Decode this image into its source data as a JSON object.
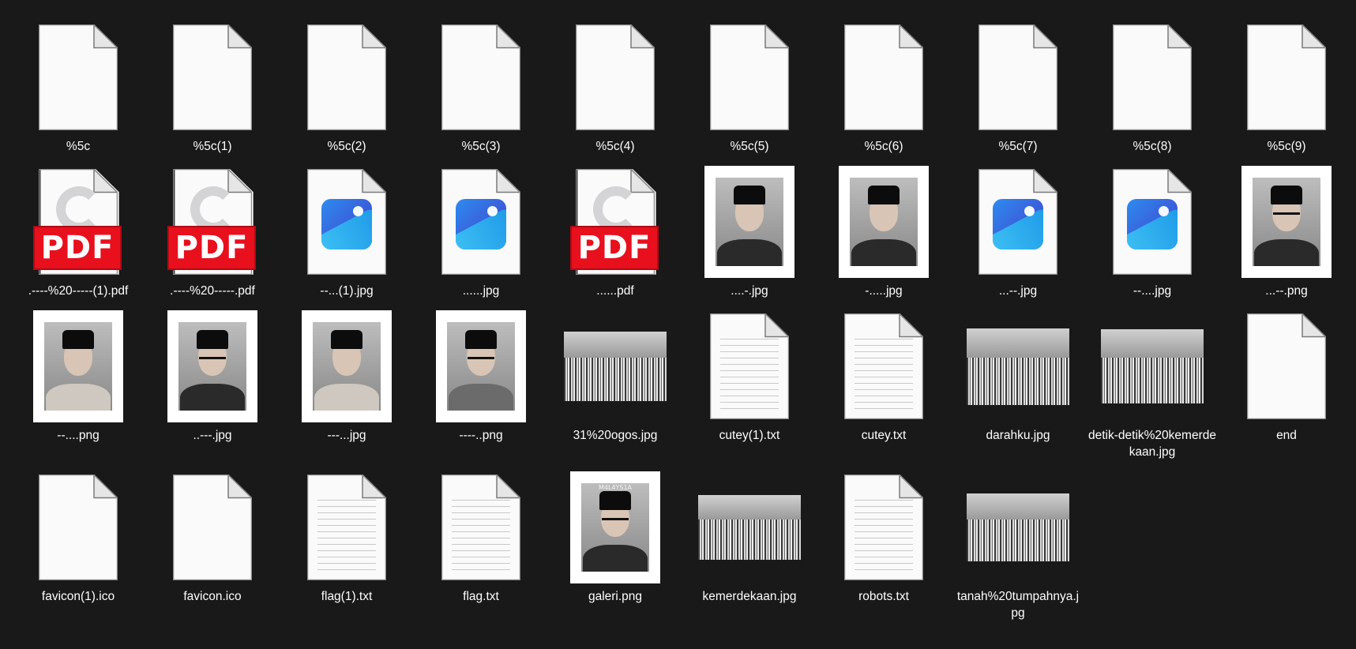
{
  "files": [
    {
      "name": "%5c",
      "kind": "blank"
    },
    {
      "name": "%5c(1)",
      "kind": "blank"
    },
    {
      "name": "%5c(2)",
      "kind": "blank"
    },
    {
      "name": "%5c(3)",
      "kind": "blank"
    },
    {
      "name": "%5c(4)",
      "kind": "blank"
    },
    {
      "name": "%5c(5)",
      "kind": "blank"
    },
    {
      "name": "%5c(6)",
      "kind": "blank"
    },
    {
      "name": "%5c(7)",
      "kind": "blank"
    },
    {
      "name": "%5c(8)",
      "kind": "blank"
    },
    {
      "name": "%5c(9)",
      "kind": "blank"
    },
    {
      "name": ".----%20-----(1).pdf",
      "kind": "pdf"
    },
    {
      "name": ".----%20-----.pdf",
      "kind": "pdf"
    },
    {
      "name": "--...(1).jpg",
      "kind": "image-icon"
    },
    {
      "name": "......jpg",
      "kind": "image-icon"
    },
    {
      "name": "......pdf",
      "kind": "pdf"
    },
    {
      "name": "....-.jpg",
      "kind": "portrait",
      "tone": "dark",
      "glasses": false
    },
    {
      "name": "-.....jpg",
      "kind": "portrait",
      "tone": "dark",
      "glasses": false
    },
    {
      "name": "...--.jpg",
      "kind": "image-icon"
    },
    {
      "name": "--....jpg",
      "kind": "image-icon"
    },
    {
      "name": "...--.png",
      "kind": "portrait",
      "tone": "dark",
      "glasses": true
    },
    {
      "name": "--....png",
      "kind": "portrait",
      "tone": "light",
      "glasses": false
    },
    {
      "name": "..---.jpg",
      "kind": "portrait",
      "tone": "dark",
      "glasses": true
    },
    {
      "name": "---...jpg",
      "kind": "portrait",
      "tone": "light",
      "glasses": false
    },
    {
      "name": "----..png",
      "kind": "portrait",
      "tone": "mid",
      "glasses": true
    },
    {
      "name": "31%20ogos.jpg",
      "kind": "photo",
      "w": 130,
      "h": 88
    },
    {
      "name": "cutey(1).txt",
      "kind": "text"
    },
    {
      "name": "cutey.txt",
      "kind": "text"
    },
    {
      "name": "darahku.jpg",
      "kind": "photo",
      "w": 130,
      "h": 97
    },
    {
      "name": "detik-detik%20kemerdekaan.jpg",
      "kind": "photo",
      "w": 130,
      "h": 94
    },
    {
      "name": "end",
      "kind": "blank"
    },
    {
      "name": "favicon(1).ico",
      "kind": "blank"
    },
    {
      "name": "favicon.ico",
      "kind": "blank"
    },
    {
      "name": "flag(1).txt",
      "kind": "text"
    },
    {
      "name": "flag.txt",
      "kind": "text"
    },
    {
      "name": "galeri.png",
      "kind": "portrait",
      "tone": "dark",
      "glasses": true,
      "caption": "M4L4YS1A"
    },
    {
      "name": "kemerdekaan.jpg",
      "kind": "photo",
      "w": 130,
      "h": 82
    },
    {
      "name": "robots.txt",
      "kind": "text"
    },
    {
      "name": "tanah%20tumpahnya.jpg",
      "kind": "photo",
      "w": 130,
      "h": 86
    }
  ]
}
